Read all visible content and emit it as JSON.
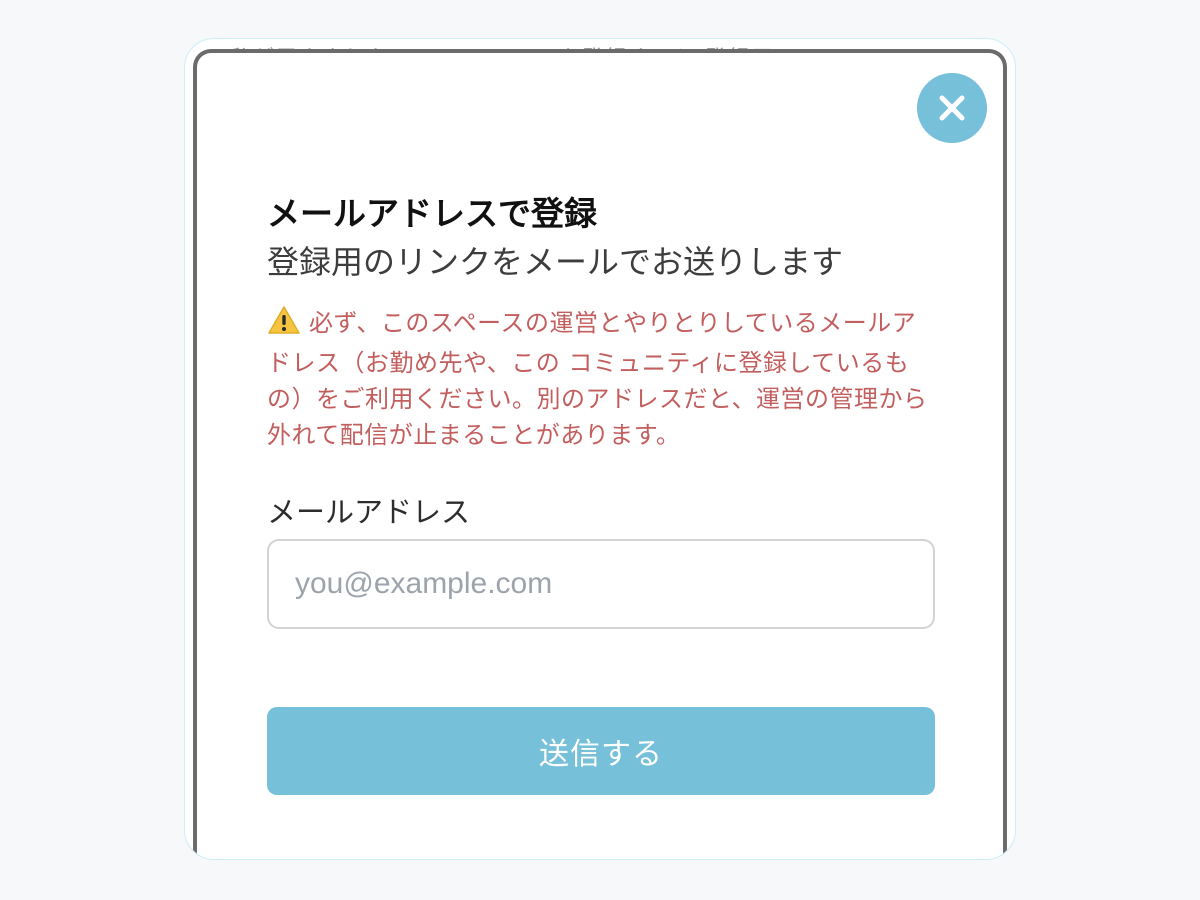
{
  "background_hint": {
    "text": "私が届きました メールアドレスを登録すると 登録用のリ"
  },
  "modal": {
    "close_icon": "close-icon",
    "title": "メールアドレスで登録",
    "subtitle": "登録用のリンクをメールでお送りします",
    "warning_icon": "warning-icon",
    "warning_text": "必ず、このスペースの運営とやりとりしているメールアドレス（お勤め先や、この コミュニティに登録しているもの）をご利用ください。別のアドレスだと、運営の管理から 外れて配信が止まることがあります。",
    "email_label": "メールアドレス",
    "email_placeholder": "you@example.com",
    "email_value": "",
    "submit_label": "送信する"
  },
  "colors": {
    "accent": "#76c0da",
    "warning_text": "#c35e5e",
    "warning_icon": "#f5c542"
  }
}
